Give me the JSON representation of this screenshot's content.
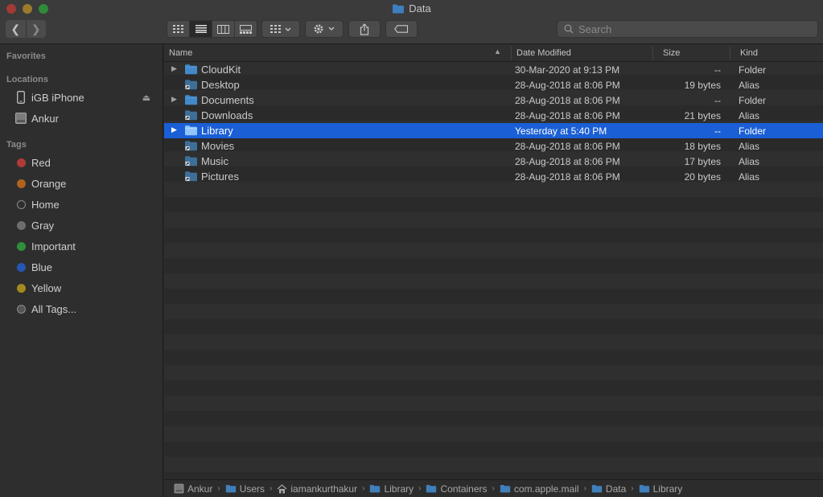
{
  "window": {
    "title": "Data"
  },
  "toolbar": {
    "back": "❮",
    "forward": "❯",
    "view_modes": [
      "icon-view",
      "list-view",
      "column-view",
      "gallery-view"
    ],
    "active_view": "list-view",
    "search_placeholder": "Search"
  },
  "sidebar": {
    "favorites_heading": "Favorites",
    "locations_heading": "Locations",
    "locations": [
      {
        "label": "iGB iPhone",
        "icon": "iphone-icon"
      },
      {
        "label": "Ankur",
        "icon": "hard-drive-icon"
      }
    ],
    "tags_heading": "Tags",
    "tags": [
      {
        "label": "Red",
        "color": "#b03a36"
      },
      {
        "label": "Orange",
        "color": "#b0621f"
      },
      {
        "label": "Home",
        "color": ""
      },
      {
        "label": "Gray",
        "color": "#6e6e6e"
      },
      {
        "label": "Important",
        "color": "#2f8f3a"
      },
      {
        "label": "Blue",
        "color": "#2656b3"
      },
      {
        "label": "Yellow",
        "color": "#a5891d"
      },
      {
        "label": "All Tags...",
        "color": "all"
      }
    ]
  },
  "columns": {
    "name": "Name",
    "date": "Date Modified",
    "size": "Size",
    "kind": "Kind"
  },
  "files": [
    {
      "name": "CloudKit",
      "date": "30-Mar-2020 at 9:13 PM",
      "size": "--",
      "kind": "Folder",
      "type": "folder",
      "expandable": true,
      "selected": false
    },
    {
      "name": "Desktop",
      "date": "28-Aug-2018 at 8:06 PM",
      "size": "19 bytes",
      "kind": "Alias",
      "type": "alias",
      "expandable": false,
      "selected": false
    },
    {
      "name": "Documents",
      "date": "28-Aug-2018 at 8:06 PM",
      "size": "--",
      "kind": "Folder",
      "type": "folder",
      "expandable": true,
      "selected": false
    },
    {
      "name": "Downloads",
      "date": "28-Aug-2018 at 8:06 PM",
      "size": "21 bytes",
      "kind": "Alias",
      "type": "alias",
      "expandable": false,
      "selected": false
    },
    {
      "name": "Library",
      "date": "Yesterday at 5:40 PM",
      "size": "--",
      "kind": "Folder",
      "type": "folder",
      "expandable": true,
      "selected": true
    },
    {
      "name": "Movies",
      "date": "28-Aug-2018 at 8:06 PM",
      "size": "18 bytes",
      "kind": "Alias",
      "type": "alias",
      "expandable": false,
      "selected": false
    },
    {
      "name": "Music",
      "date": "28-Aug-2018 at 8:06 PM",
      "size": "17 bytes",
      "kind": "Alias",
      "type": "alias",
      "expandable": false,
      "selected": false
    },
    {
      "name": "Pictures",
      "date": "28-Aug-2018 at 8:06 PM",
      "size": "20 bytes",
      "kind": "Alias",
      "type": "alias",
      "expandable": false,
      "selected": false
    }
  ],
  "pathbar": [
    {
      "label": "Ankur",
      "icon": "hard-drive-icon"
    },
    {
      "label": "Users",
      "icon": "folder-icon"
    },
    {
      "label": "iamankurthakur",
      "icon": "home-icon"
    },
    {
      "label": "Library",
      "icon": "folder-icon"
    },
    {
      "label": "Containers",
      "icon": "folder-icon"
    },
    {
      "label": "com.apple.mail",
      "icon": "folder-icon"
    },
    {
      "label": "Data",
      "icon": "folder-icon"
    },
    {
      "label": "Library",
      "icon": "folder-icon"
    }
  ]
}
